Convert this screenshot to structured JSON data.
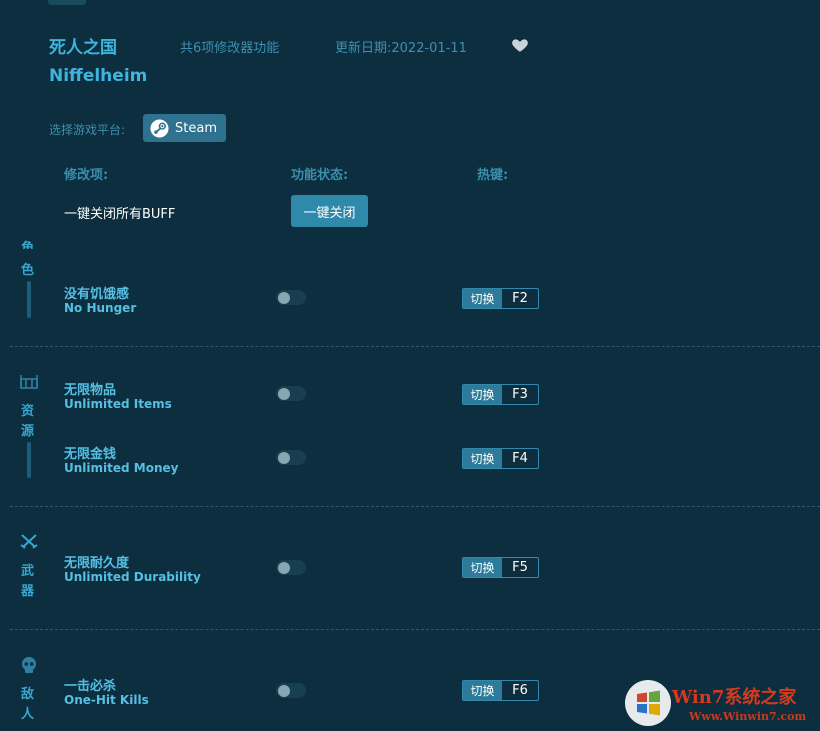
{
  "header": {
    "title_cn": "死人之国",
    "title_en": "Niffelheim",
    "feature_count": "共6项修改器功能",
    "update_date": "更新日期:2022-01-11"
  },
  "platform": {
    "label": "选择游戏平台:",
    "steam_label": "Steam"
  },
  "columns": {
    "name": "修改项:",
    "status": "功能状态:",
    "hotkey": "热键:"
  },
  "buff": {
    "label": "一键关闭所有BUFF",
    "button": "一键关闭"
  },
  "categories": [
    {
      "chars": [
        "角",
        "色"
      ]
    },
    {
      "chars": [
        "资",
        "源"
      ]
    },
    {
      "chars": [
        "武",
        "器"
      ]
    },
    {
      "chars": [
        "敌",
        "人"
      ]
    }
  ],
  "cheats": [
    {
      "cn": "没有饥饿感",
      "en": "No Hunger",
      "switch": "切换",
      "key": "F2",
      "on": false
    },
    {
      "cn": "无限物品",
      "en": "Unlimited Items",
      "switch": "切换",
      "key": "F3",
      "on": false
    },
    {
      "cn": "无限金钱",
      "en": "Unlimited Money",
      "switch": "切换",
      "key": "F4",
      "on": false
    },
    {
      "cn": "无限耐久度",
      "en": "Unlimited Durability",
      "switch": "切换",
      "key": "F5",
      "on": false
    },
    {
      "cn": "一击必杀",
      "en": "One-Hit Kills",
      "switch": "切换",
      "key": "F6",
      "on": false
    }
  ],
  "watermark": {
    "text": "Win7系统之家",
    "url": "Www.Winwin7.com"
  },
  "colors": {
    "background": "#0c2e3f",
    "accent": "#3fb4dc",
    "button": "#2f89aa"
  }
}
